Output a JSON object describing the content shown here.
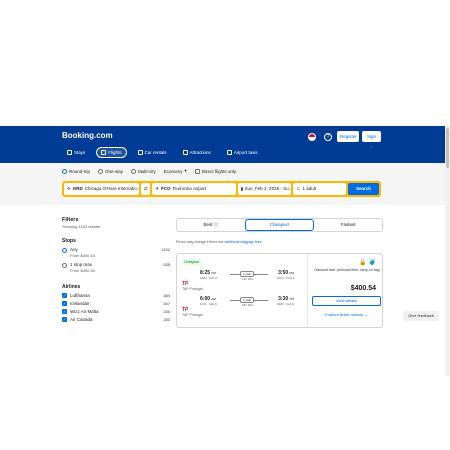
{
  "header": {
    "logo": "Booking.com",
    "register": "Register",
    "signin": "Sign in",
    "nav": [
      {
        "label": "Stays",
        "icon": "bed-icon"
      },
      {
        "label": "Flights",
        "icon": "plane-icon",
        "active": true
      },
      {
        "label": "Car rentals",
        "icon": "car-icon"
      },
      {
        "label": "Attractions",
        "icon": "attractions-icon"
      },
      {
        "label": "Airport taxis",
        "icon": "taxi-icon"
      }
    ]
  },
  "search": {
    "trip_types": [
      "Round-trip",
      "One-way",
      "Multi-city"
    ],
    "selected_trip": "Round-trip",
    "cabin": "Economy",
    "direct_only": "Direct flights only",
    "origin_code": "ORD",
    "origin_name": "Chicago O'Hare Internatio...",
    "dest_code": "FCO",
    "dest_name": "Fiumicino Airport",
    "dates": "Sun, Feb 2, 2025 - Su...",
    "passengers": "1 adult",
    "search_label": "Search"
  },
  "filters": {
    "title": "Filters",
    "count": "Showing 1152 results",
    "stops_title": "Stops",
    "stops": [
      {
        "label": "Any",
        "sub": "From $400.54",
        "count": "1152",
        "selected": true
      },
      {
        "label": "1 stop max",
        "sub": "From $400.54",
        "count": "535",
        "selected": false
      }
    ],
    "airlines_title": "Airlines",
    "airlines": [
      {
        "label": "Lufthansa",
        "count": "384"
      },
      {
        "label": "Icelandair",
        "count": "347"
      },
      {
        "label": "Wizz Air Malta",
        "count": "330"
      },
      {
        "label": "Air Canada",
        "count": "283"
      }
    ]
  },
  "sort_tabs": [
    "Best",
    "Cheapest",
    "Fastest"
  ],
  "active_tab": "Cheapest",
  "notice": {
    "text": "Prices may change if there are ",
    "link": "additional baggage fees"
  },
  "result": {
    "badge": "Cheapest",
    "legs": [
      {
        "dep_time": "8:25",
        "dep_ampm": "PM",
        "dep_info": "ORD · Feb 2",
        "stops": "1 stop",
        "duration": "12h 25m",
        "arr_time": "3:50",
        "arr_ampm": "PM",
        "arr_info": "FCO · Feb 3"
      },
      {
        "dep_time": "6:00",
        "dep_ampm": "AM",
        "dep_info": "FCO · Feb 9",
        "stops": "1 stop",
        "duration": "16h 30m",
        "arr_time": "3:30",
        "arr_ampm": "PM",
        "arr_info": "ORD · Feb 9"
      }
    ],
    "carrier": "TAP Portugal",
    "airline_logo_text": "TP",
    "bag_note": "Discount fare: personal item, carry-on bag",
    "price": "$400.54",
    "view_details": "View details",
    "explore": "Explore ticket options"
  },
  "feedback": "Give feedback",
  "colors": {
    "brand": "#003b95",
    "accent": "#006ce4",
    "search_border": "#ffb700"
  }
}
